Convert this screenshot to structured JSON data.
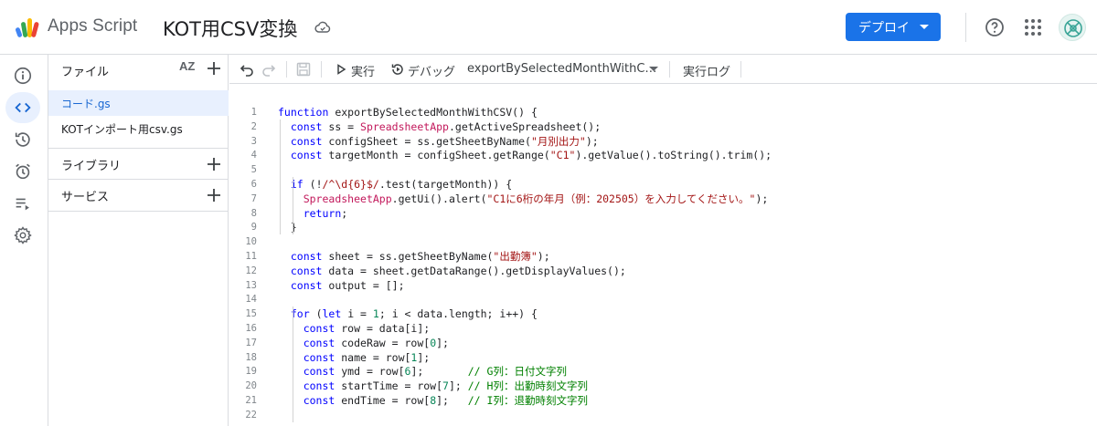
{
  "header": {
    "app_name": "Apps Script",
    "project_title": "KOT用CSV変換",
    "deploy_label": "デプロイ"
  },
  "rail": {
    "items": [
      "overview",
      "editor",
      "executions",
      "triggers",
      "executions-log",
      "settings"
    ],
    "active": "editor"
  },
  "files_panel": {
    "title": "ファイル",
    "sort_label": "AZ",
    "files": [
      "コード.gs",
      "KOTインポート用csv.gs"
    ],
    "selected_file": "コード.gs",
    "libraries_label": "ライブラリ",
    "services_label": "サービス"
  },
  "toolbar": {
    "run_label": "実行",
    "debug_label": "デバッグ",
    "function_name": "exportBySelectedMonthWithC…",
    "log_label": "実行ログ"
  },
  "code_lines": [
    "function exportBySelectedMonthWithCSV() {",
    "  const ss = SpreadsheetApp.getActiveSpreadsheet();",
    "  const configSheet = ss.getSheetByName(\"月別出力\");",
    "  const targetMonth = configSheet.getRange(\"C1\").getValue().toString().trim();",
    "",
    "  if (!/^\\d{6}$/.test(targetMonth)) {",
    "    SpreadsheetApp.getUi().alert(\"C1に6桁の年月（例：202505）を入力してください。\");",
    "    return;",
    "  }",
    "",
    "  const sheet = ss.getSheetByName(\"出勤簿\");",
    "  const data = sheet.getDataRange().getDisplayValues();",
    "  const output = [];",
    "",
    "  for (let i = 1; i < data.length; i++) {",
    "    const row = data[i];",
    "    const codeRaw = row[0];",
    "    const name = row[1];",
    "    const ymd = row[6];       // G列：日付文字列",
    "    const startTime = row[7]; // H列：出勤時刻文字列",
    "    const endTime = row[8];   // I列：退勤時刻文字列",
    ""
  ]
}
